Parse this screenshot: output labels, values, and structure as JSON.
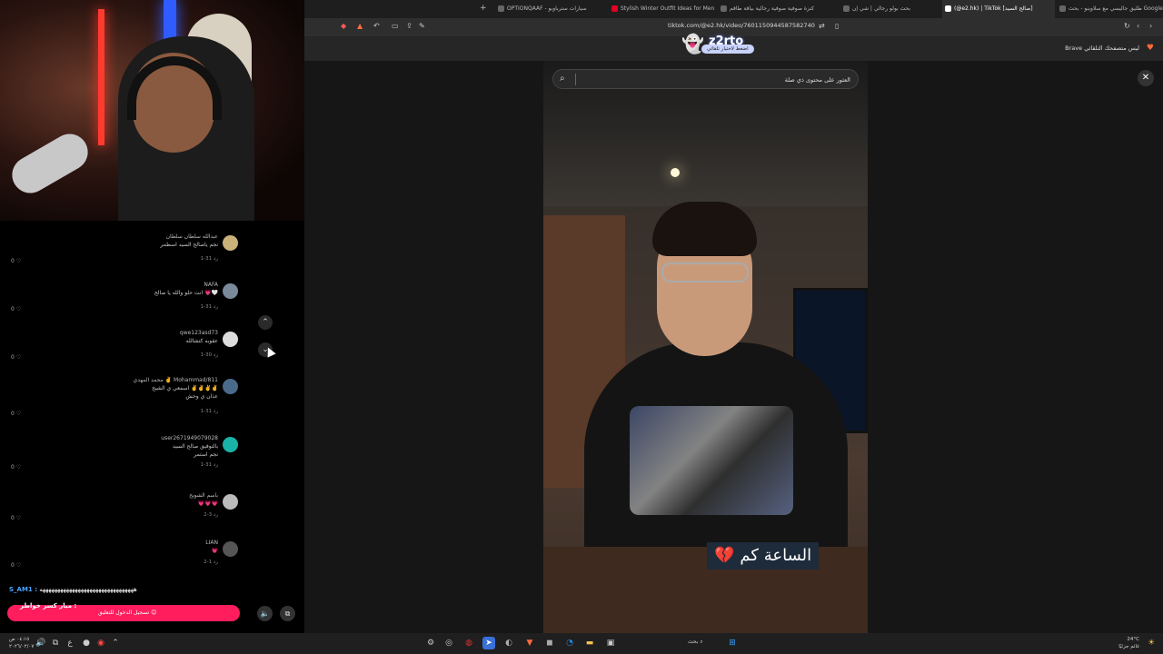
{
  "browser": {
    "tabs": [
      {
        "label": "طليق جاليسي مع سلاوينو - بحث Google",
        "active": false
      },
      {
        "label": "(@e2.hk) | TikTok [صالح السيد]",
        "active": true
      },
      {
        "label": "بحث بولو رجالي | شي إن",
        "active": false
      },
      {
        "label": "كنزة صوفية صوفية رجالية بياقة طاقم",
        "active": false
      },
      {
        "label": "Stylish Winter Outfit Ideas for Men",
        "active": false
      },
      {
        "label": "OPTIONQAAF - سيارات سترباوبو",
        "active": false
      }
    ],
    "new_tab_label": "+",
    "url": "tiktok.com/@e2.hk/video/7601150944587582740",
    "brave_notice": "Brave ليس متصفحك التلقائي",
    "z2rto": {
      "brand": "z2rto",
      "pill": "اضغط لاختيار تلقائي"
    }
  },
  "viewer": {
    "search_placeholder": "العثور على محتوى ذي صلة",
    "caption": "الساعة كم",
    "caption_emoji": "💔",
    "close_label": "✕"
  },
  "comments": [
    {
      "user": "عبدالله سلطان سلطان",
      "text": "نجم ياصالح السيد اسطمر",
      "meta": "1-31   رد",
      "likes": "0 ♡",
      "avatar_color": "#c9b27a"
    },
    {
      "user": "NAFA",
      "text": "انت حلو والله يا صالح 💗🤍",
      "meta": "1-31   رد",
      "likes": "0 ♡",
      "avatar_color": "#7a8a9a"
    },
    {
      "user": "qwe123asd73",
      "text": "عقوبه كتشالله",
      "meta": "1-30   رد",
      "likes": "0 ♡",
      "avatar_color": "#dddddd"
    },
    {
      "user": "محمد المهدي ✌️ Mohammad/811",
      "text": "اسمعي ي الشيخ ✌️✌️✌️✌️",
      "text2": "عذان ي وحش",
      "meta": "1-31   رد",
      "likes": "0 ♡",
      "avatar_color": "#4a6a8a"
    },
    {
      "user": "user2671949079028",
      "text": "بالتوفيق صالح السيد",
      "text2": "نجم استمر",
      "meta": "1-31   رد",
      "likes": "0 ♡",
      "avatar_color": "#1ab3a8"
    },
    {
      "user": "باسم الشويخ",
      "text": "💗💗💗",
      "meta": "2-3   رد",
      "likes": "0 ♡",
      "avatar_color": "#bbbbbb"
    },
    {
      "user": "LIAN",
      "text": "💗",
      "meta": "2-1   رد",
      "likes": "0 ♡",
      "avatar_color": "#555555"
    }
  ],
  "live": {
    "name": "S_AM1 :",
    "message": "ههههههههههههههههههههههههههههههههه",
    "pink_tag": "ميار كسر خواطر :",
    "pink_sub": "تسجيل الدخول للتعليق 😊"
  },
  "taskbar": {
    "search_label": "بحث",
    "time": "٠٤:١٥ ص",
    "date": "٢٠٢٦/٠٢/٠٧",
    "temp": "24°C",
    "weather": "غائم جزئيًا"
  }
}
